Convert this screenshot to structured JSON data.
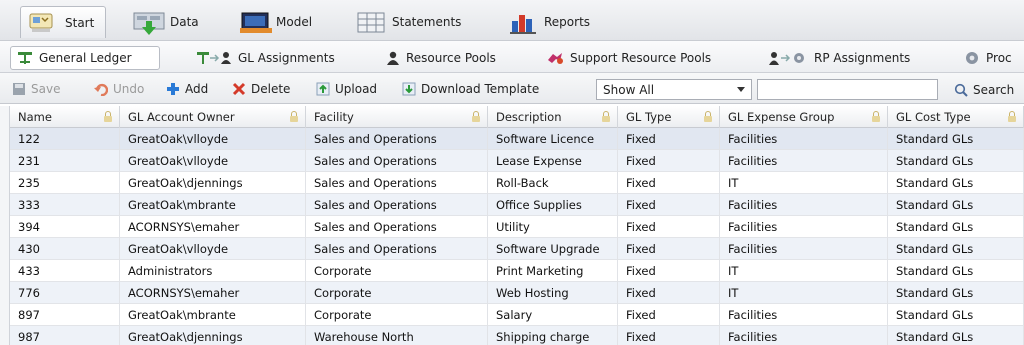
{
  "top_tabs": [
    {
      "label": "Start",
      "icon": "start-icon",
      "active": true
    },
    {
      "label": "Data",
      "icon": "data-icon"
    },
    {
      "label": "Model",
      "icon": "model-icon"
    },
    {
      "label": "Statements",
      "icon": "statements-icon"
    },
    {
      "label": "Reports",
      "icon": "reports-icon"
    }
  ],
  "sub_tabs": [
    {
      "label": "General Ledger",
      "icon": "ledger-icon",
      "active": true
    },
    {
      "label": "GL Assignments",
      "icon": "gl-assignments-icon"
    },
    {
      "label": "Resource Pools",
      "icon": "resource-pools-icon"
    },
    {
      "label": "Support Resource Pools",
      "icon": "support-resource-pools-icon"
    },
    {
      "label": "RP Assignments",
      "icon": "rp-assignments-icon"
    },
    {
      "label": "Proc",
      "icon": "processes-icon"
    }
  ],
  "toolbar": {
    "save": "Save",
    "undo": "Undo",
    "add": "Add",
    "delete": "Delete",
    "upload": "Upload",
    "download_template": "Download Template",
    "filter_value": "Show All",
    "search_value": "",
    "search": "Search"
  },
  "colors": {
    "add": "#2a7ad6",
    "delete": "#d43a2a",
    "accent": "#3a6fb0"
  },
  "columns": [
    "Name",
    "GL Account Owner",
    "Facility",
    "Description",
    "GL Type",
    "GL Expense Group",
    "GL Cost Type"
  ],
  "rows": [
    [
      "122",
      "GreatOak\\vlloyde",
      "Sales and Operations",
      "Software Licence",
      "Fixed",
      "Facilities",
      "Standard GLs"
    ],
    [
      "231",
      "GreatOak\\vlloyde",
      "Sales and Operations",
      "Lease Expense",
      "Fixed",
      "Facilities",
      "Standard GLs"
    ],
    [
      "235",
      "GreatOak\\djennings",
      "Sales and Operations",
      "Roll-Back",
      "Fixed",
      "IT",
      "Standard GLs"
    ],
    [
      "333",
      "GreatOak\\mbrante",
      "Sales and Operations",
      "Office Supplies",
      "Fixed",
      "Facilities",
      "Standard GLs"
    ],
    [
      "394",
      "ACORNSYS\\emaher",
      "Sales and Operations",
      "Utility",
      "Fixed",
      "Facilities",
      "Standard GLs"
    ],
    [
      "430",
      "GreatOak\\vlloyde",
      "Sales and Operations",
      "Software Upgrade",
      "Fixed",
      "Facilities",
      "Standard GLs"
    ],
    [
      "433",
      "Administrators",
      "Corporate",
      "Print Marketing",
      "Fixed",
      "IT",
      "Standard GLs"
    ],
    [
      "776",
      "ACORNSYS\\emaher",
      "Corporate",
      "Web Hosting",
      "Fixed",
      "IT",
      "Standard GLs"
    ],
    [
      "897",
      "GreatOak\\mbrante",
      "Corporate",
      "Salary",
      "Fixed",
      "Facilities",
      "Standard GLs"
    ],
    [
      "987",
      "GreatOak\\djennings",
      "Warehouse North",
      "Shipping charge",
      "Fixed",
      "Facilities",
      "Standard GLs"
    ]
  ]
}
